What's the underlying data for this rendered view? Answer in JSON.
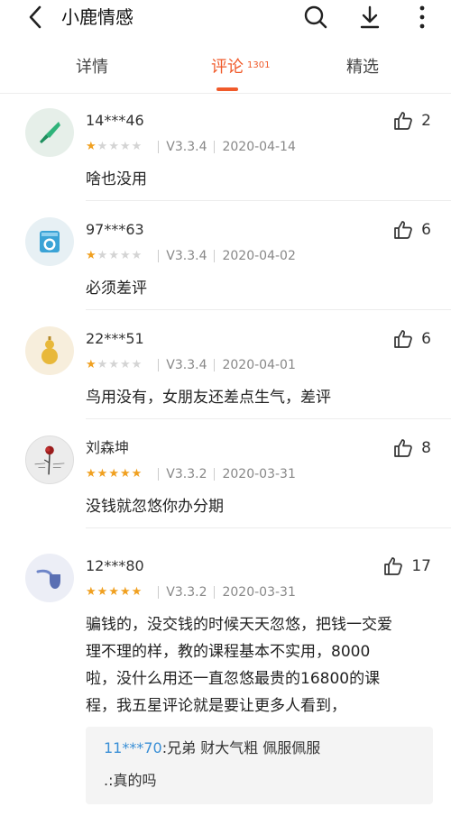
{
  "header": {
    "title": "小鹿情感"
  },
  "tabs": [
    {
      "label": "详情"
    },
    {
      "label": "评论",
      "count": "1301"
    },
    {
      "label": "精选"
    }
  ],
  "colors": {
    "accent": "#f05a2a",
    "star": "#f0a020",
    "reply_user": "#3a8fd6"
  },
  "reviews": [
    {
      "user": "14***46",
      "likes": "2",
      "stars": 1,
      "version": "V3.3.4",
      "date": "2020-04-14",
      "content": "啥也没用",
      "avatar": "knife-icon"
    },
    {
      "user": "97***63",
      "likes": "6",
      "stars": 1,
      "version": "V3.3.4",
      "date": "2020-04-02",
      "content": "必须差评",
      "avatar": "washing-machine-icon"
    },
    {
      "user": "22***51",
      "likes": "6",
      "stars": 1,
      "version": "V3.3.4",
      "date": "2020-04-01",
      "content": "鸟用没有，女朋友还差点生气，差评",
      "avatar": "gourd-icon"
    },
    {
      "user": "刘森坤",
      "likes": "8",
      "stars": 5,
      "version": "V3.3.2",
      "date": "2020-03-31",
      "content": "没钱就忽悠你办分期",
      "avatar": "rose-photo-avatar"
    },
    {
      "user": "12***80",
      "likes": "17",
      "stars": 5,
      "version": "V3.3.2",
      "date": "2020-03-31",
      "content_lines": [
        "骗钱的，没交钱的时候天天忽悠，把钱一交爱",
        "理不理的样，教的课程基本不实用，8000",
        "啦，没什么用还一直忽悠最贵的16800的课",
        "程，我五星评论就是要让更多人看到，"
      ],
      "avatar": "pipe-icon",
      "replies": [
        {
          "user": "11***70",
          "text": ":兄弟 财大气粗 佩服佩服"
        },
        {
          "user": "",
          "text": ".:真的吗"
        }
      ]
    }
  ]
}
